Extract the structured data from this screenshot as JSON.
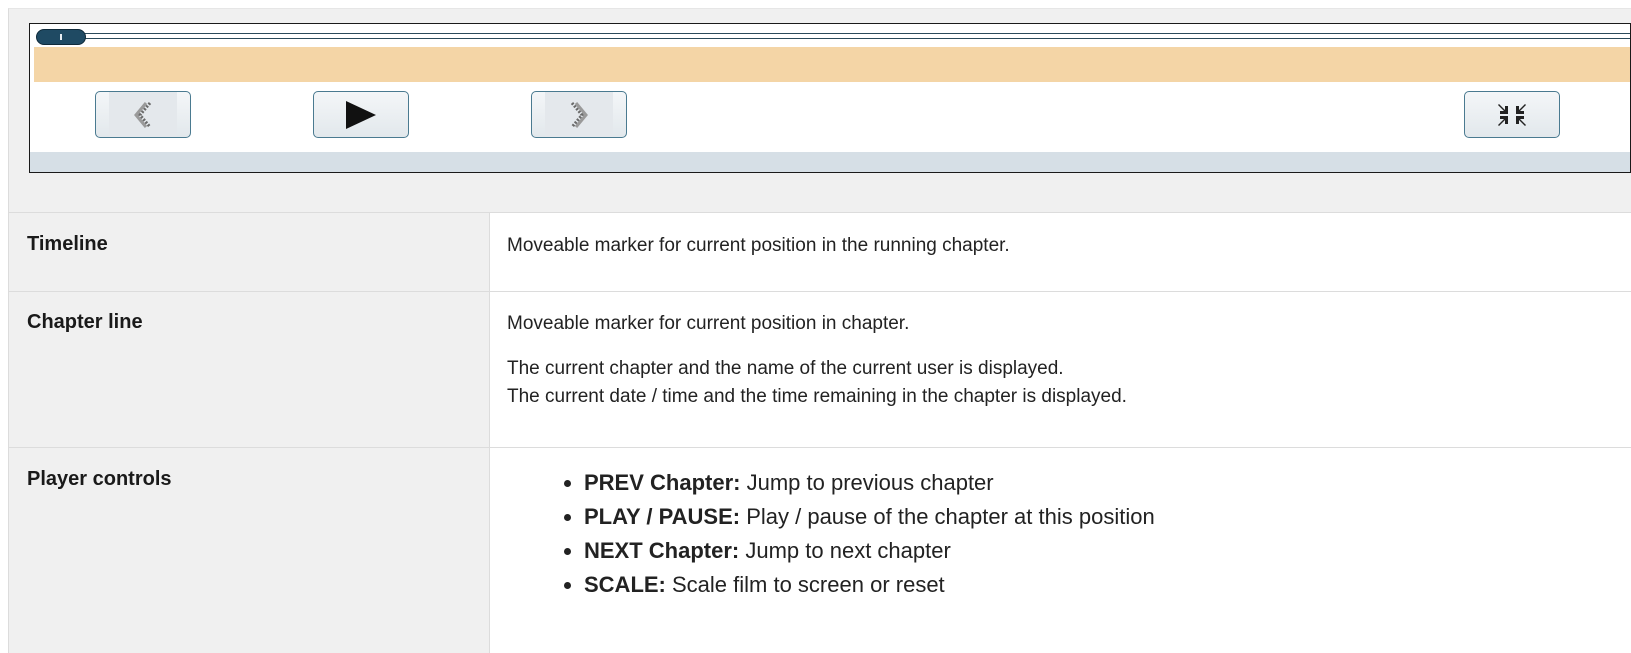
{
  "player": {
    "timeline_position": 0.0,
    "buttons": [
      {
        "name": "prev-chapter-button",
        "icon": "double-chevron-left-icon"
      },
      {
        "name": "play-button",
        "icon": "play-icon"
      },
      {
        "name": "next-chapter-button",
        "icon": "double-chevron-right-icon"
      },
      {
        "name": "scale-button",
        "icon": "compress-icon"
      }
    ],
    "colors": {
      "chapter_line": "#f4d5a6",
      "marker": "#1f4a63",
      "bottom_bar": "#d6dfe6"
    }
  },
  "table": {
    "rows": [
      {
        "label": "Timeline",
        "lines": [
          "Moveable marker for current position in the running chapter."
        ]
      },
      {
        "label": "Chapter line",
        "lines": [
          "Moveable marker for current position in chapter.",
          "The current chapter and the name of the current user is displayed.",
          "The current date / time and the time remaining in the chapter is displayed."
        ]
      },
      {
        "label": "Player controls",
        "items": [
          {
            "term": "PREV Chapter:",
            "text": " Jump to previous chapter"
          },
          {
            "term": "PLAY / PAUSE:",
            "text": " Play / pause of the chapter at this position"
          },
          {
            "term": "NEXT Chapter:",
            "text": " Jump to next chapter"
          },
          {
            "term": "SCALE:",
            "text": " Scale film to screen or reset"
          }
        ]
      }
    ]
  }
}
